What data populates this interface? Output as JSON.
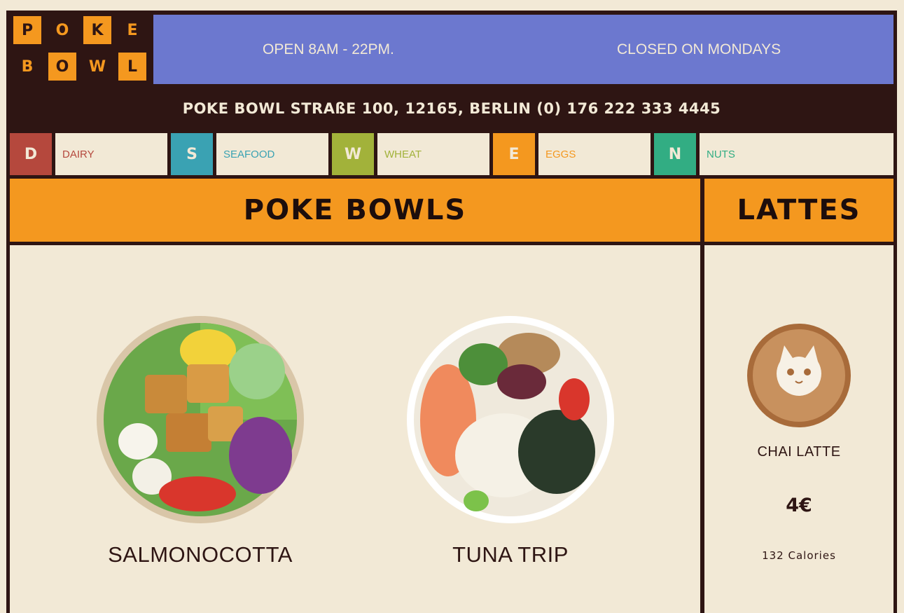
{
  "logo": {
    "letters": [
      "P",
      "O",
      "K",
      "E",
      "B",
      "O",
      "W",
      "L"
    ]
  },
  "header": {
    "hours": "OPEN 8AM - 22PM.",
    "closed": "CLOSED ON MONDAYS",
    "address": "POKE BOWL STRAßE 100, 12165, BERLIN (0) 176 222 333 4445"
  },
  "allergens": [
    {
      "letter": "D",
      "label": "DAIRY",
      "color": "#b5483d"
    },
    {
      "letter": "S",
      "label": "SEAFOOD",
      "color": "#3aa2b3"
    },
    {
      "letter": "W",
      "label": "WHEAT",
      "color": "#a2b23a"
    },
    {
      "letter": "E",
      "label": "EGGS",
      "color": "#f4981f"
    },
    {
      "letter": "N",
      "label": "NUTS",
      "color": "#32ad83"
    }
  ],
  "sections": {
    "bowls_title": "POKE BOWLS",
    "lattes_title": "LATTES"
  },
  "bowls": [
    {
      "name": "SALMONOCOTTA"
    },
    {
      "name": "TUNA TRIP"
    }
  ],
  "lattes": [
    {
      "name": "CHAI LATTE",
      "price": "4€",
      "calories": "132 Calories"
    }
  ],
  "colors": {
    "dark": "#2e1513",
    "orange": "#f4981f",
    "blue": "#6c78cf",
    "cream": "#f2e9d6"
  }
}
